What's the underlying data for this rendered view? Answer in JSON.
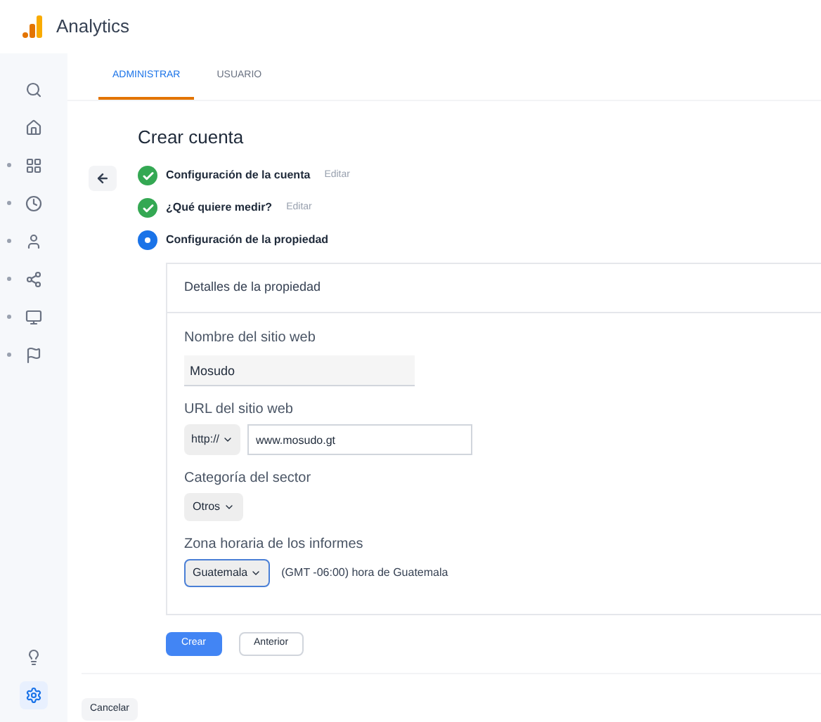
{
  "header": {
    "title": "Analytics"
  },
  "tabs": [
    {
      "label": "ADMINISTRAR",
      "selected": true
    },
    {
      "label": "USUARIO",
      "selected": false
    }
  ],
  "sidebar": {
    "items": [
      {
        "expandable": false,
        "selected": false
      },
      {
        "expandable": false,
        "selected": false
      },
      {
        "expandable": true,
        "selected": false
      },
      {
        "expandable": true,
        "selected": false
      },
      {
        "expandable": true,
        "selected": false
      },
      {
        "expandable": true,
        "selected": false
      },
      {
        "expandable": true,
        "selected": false
      },
      {
        "expandable": true,
        "selected": false
      }
    ],
    "bottom": [
      {
        "selected": false
      },
      {
        "selected": true
      }
    ]
  },
  "page_title": "Crear cuenta",
  "steps": [
    {
      "kind": "done",
      "label": "Configuración de la cuenta",
      "action": "Editar"
    },
    {
      "kind": "done",
      "label": "¿Qué quiere medir?",
      "action": "Editar"
    },
    {
      "kind": "current",
      "label": "Configuración de la propiedad"
    }
  ],
  "card": {
    "title": "Detalles de la propiedad",
    "fields": [
      {
        "kind": "text",
        "label": "Nombre del sitio web",
        "value": "Mosudo"
      },
      {
        "kind": "url",
        "label": "URL del sitio web",
        "protocol": "http://",
        "value": "www.mosudo.gt"
      },
      {
        "kind": "select",
        "label": "Categoría del sector",
        "value": "Otros"
      },
      {
        "kind": "timezone",
        "label": "Zona horaria de los informes",
        "value": "Guatemala",
        "zone": "(GMT -06:00) hora de Guatemala"
      }
    ]
  },
  "buttons": [
    {
      "label": "Crear",
      "kind": "primary"
    },
    {
      "label": "Anterior",
      "kind": "secondary"
    }
  ],
  "cancel": "Cancelar"
}
